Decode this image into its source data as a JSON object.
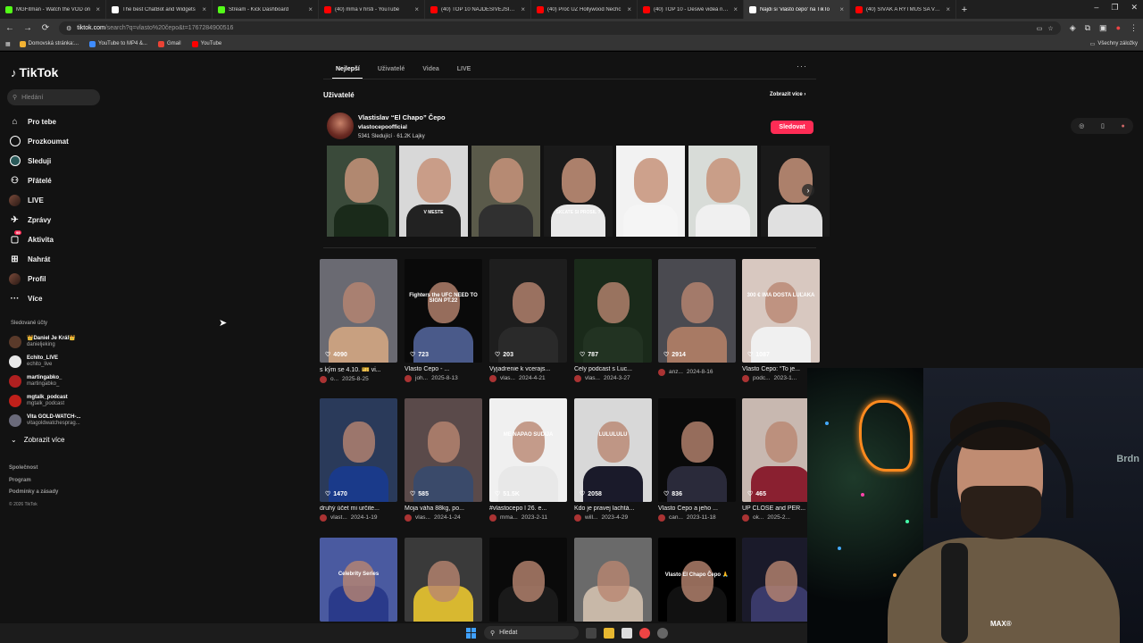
{
  "browser": {
    "tabs": [
      {
        "title": "MGFitman - Watch the VOD on",
        "icon_color": "#53fc18",
        "active": false
      },
      {
        "title": "The best ChatBot and Widgets",
        "icon_color": "#ffffff",
        "active": false
      },
      {
        "title": "Stream - Kick Dashboard",
        "icon_color": "#53fc18",
        "active": false
      },
      {
        "title": "(40) mma v hrsti - YouTube",
        "icon_color": "#ff0000",
        "active": false
      },
      {
        "title": "(40) TOP 10 NAJDESIVEJŠÍCH P",
        "icon_color": "#ff0000",
        "active": false
      },
      {
        "title": "(40) Proč UŽ Hollywood Nechc",
        "icon_color": "#ff0000",
        "active": false
      },
      {
        "title": "(40) TOP 10 - Desivé videá natc",
        "icon_color": "#ff0000",
        "active": false
      },
      {
        "title": "Nájdi si 'vlasto čepo' na TikTo",
        "icon_color": "#ffffff",
        "active": true
      },
      {
        "title": "(40) SIVÁK A RYTMUS SA VYJAD",
        "icon_color": "#ff0000",
        "active": false
      }
    ],
    "close_glyph": "×",
    "new_tab_glyph": "+",
    "window_controls": [
      "–",
      "❐",
      "✕"
    ],
    "url_host": "tiktok.com",
    "url_path": "/search?q=vlasto%20čepo&t=1767284900516",
    "bookmarks": [
      {
        "label": "Domovská stránka:...",
        "color": "#f2b233"
      },
      {
        "label": "YouTube to MP4 &...",
        "color": "#3f8cff"
      },
      {
        "label": "Gmail",
        "color": "#ea4335"
      },
      {
        "label": "YouTube",
        "color": "#ff0000"
      }
    ],
    "bookmarks_folder": "Všechny záložky"
  },
  "sidebar": {
    "logo": "TikTok",
    "search_placeholder": "Hledání",
    "nav": [
      {
        "label": "Pro tebe",
        "icon": "home-icon"
      },
      {
        "label": "Prozkoumat",
        "icon": "compass-icon"
      },
      {
        "label": "Sleduji",
        "icon": "following-icon"
      },
      {
        "label": "Přátelé",
        "icon": "friends-icon"
      },
      {
        "label": "LIVE",
        "icon": "live-icon"
      },
      {
        "label": "Zprávy",
        "icon": "messages-icon"
      },
      {
        "label": "Aktivita",
        "icon": "activity-icon",
        "badge": "99"
      },
      {
        "label": "Nahrát",
        "icon": "upload-icon"
      },
      {
        "label": "Profil",
        "icon": "profile-icon"
      },
      {
        "label": "Více",
        "icon": "more-icon"
      }
    ],
    "followed_header": "Sledované účty",
    "accounts": [
      {
        "name": "👑Daniel Je Král👑",
        "handle": "danieljeking",
        "color": "#5a3a2a"
      },
      {
        "name": "Echito_LIVE",
        "handle": "echito_live",
        "color": "#e8e8e8"
      },
      {
        "name": "martingabko_",
        "handle": "martingabko_",
        "color": "#b02020"
      },
      {
        "name": "mgtalk_podcast",
        "handle": "mgtalk_podcast",
        "color": "#c0201a"
      },
      {
        "name": "Vita GOLD-WATCH-...",
        "handle": "vitagoldwatchesprag...",
        "color": "#6a6a7a"
      }
    ],
    "show_more": "Zobrazit více",
    "footer_links": [
      "Společnost",
      "Program",
      "Podmínky a zásady"
    ],
    "copyright": "© 2026 TikTok"
  },
  "main": {
    "tabs": [
      "Nejlepší",
      "Uživatelé",
      "Videa",
      "LIVE"
    ],
    "users_header": "Uživatelé",
    "see_more": "Zobrazit více",
    "user": {
      "name": "Vlastislav “El Chapo” Čepo",
      "handle": "vlastocepoofficial",
      "followers": "5341 Sledující",
      "likes": "61.2K Lajky",
      "follow_label": "Sledovat"
    },
    "strip": [
      {
        "caption": "",
        "bg": "#3a4a3a",
        "body": "#1a2a1a"
      },
      {
        "caption": "V MESTE",
        "bg": "#d8d8d8",
        "body": "#222"
      },
      {
        "caption": "",
        "bg": "#5a5a4a",
        "body": "#303030"
      },
      {
        "caption": "SKĽATE SI PROSIL ?",
        "bg": "#1a1a1a",
        "body": "#e8e8e8"
      },
      {
        "caption": "",
        "bg": "#f2f2f2",
        "body": "#f5f5f5"
      },
      {
        "caption": "",
        "bg": "#d8dcd8",
        "body": "#f0f0f0"
      },
      {
        "caption": "",
        "bg": "#1a1a1a",
        "body": "#e0e0e0"
      }
    ],
    "videos": [
      {
        "likes": "4090",
        "desc": "s kým se 4.10. 🎫 vi...",
        "author": "o...",
        "date": "2025-8-25",
        "bg": "#6a6a72",
        "body": "#c8a080",
        "overlay": ""
      },
      {
        "likes": "723",
        "desc": "Vlasto Čepo - ...",
        "author": "joh...",
        "date": "2025-8-13",
        "bg": "#0a0a0a",
        "body": "#4a5a8a",
        "overlay": "Fighters the UFC NEED TO SIGN PT.22"
      },
      {
        "likes": "203",
        "desc": "Vyjadrenie k vcerajs...",
        "author": "vlas...",
        "date": "2024-4-21",
        "bg": "#1e1e1e",
        "body": "#2a2a2a",
        "overlay": ""
      },
      {
        "likes": "787",
        "desc": "Cely podcast s Luc...",
        "author": "vlas...",
        "date": "2024-3-27",
        "bg": "#1a2a1a",
        "body": "#223322",
        "overlay": ""
      },
      {
        "likes": "2914",
        "desc": "",
        "author": "anz...",
        "date": "2024-8-16",
        "bg": "#4a4a50",
        "body": "#a87a64",
        "overlay": ""
      },
      {
        "likes": "1087",
        "desc": "Vlasto Čepo: “To je...",
        "author": "podc...",
        "date": "2023-1...",
        "bg": "#d8c8c0",
        "body": "#f0f0f0",
        "overlay": "300 € IMA DOSTA LUĽAKA"
      },
      {
        "likes": "1470",
        "desc": "druhý účet mi určite...",
        "author": "vlast...",
        "date": "2024-1-19",
        "bg": "#2a3a5a",
        "body": "#1a3a8a",
        "overlay": ""
      },
      {
        "likes": "585",
        "desc": "Moja váha 88kg, po...",
        "author": "vlas...",
        "date": "2024-1-24",
        "bg": "#5a4a4a",
        "body": "#3a4a6a",
        "overlay": ""
      },
      {
        "likes": "51.5K",
        "desc": "#vlastocepo l 26. e...",
        "author": "mma...",
        "date": "2023-2-11",
        "bg": "#f0f0f0",
        "body": "#e8e8e8",
        "overlay": "ME NAPAO SUDIJA"
      },
      {
        "likes": "2058",
        "desc": "Kdo je pravej lachtá...",
        "author": "will...",
        "date": "2023-4-29",
        "bg": "#d8d8d8",
        "body": "#1a1a2a",
        "overlay": "LULULULU"
      },
      {
        "likes": "836",
        "desc": "Vlasto Čepo a jeho ...",
        "author": "can...",
        "date": "2023-11-18",
        "bg": "#0a0a0a",
        "body": "#2a2a3a",
        "overlay": ""
      },
      {
        "likes": "465",
        "desc": "UP CLOSE and PER...",
        "author": "ok...",
        "date": "2025-2...",
        "bg": "#c8b8b0",
        "body": "#8a2030",
        "overlay": ""
      },
      {
        "likes": "",
        "desc": "",
        "author": "",
        "date": "",
        "bg": "#4a5aa0",
        "body": "#2a3a8a",
        "overlay": "Celebrity Series"
      },
      {
        "likes": "",
        "desc": "",
        "author": "",
        "date": "",
        "bg": "#3a3a3a",
        "body": "#d8b830",
        "overlay": ""
      },
      {
        "likes": "",
        "desc": "",
        "author": "",
        "date": "",
        "bg": "#0a0a0a",
        "body": "#1a1a1a",
        "overlay": ""
      },
      {
        "likes": "",
        "desc": "",
        "author": "",
        "date": "",
        "bg": "#6a6a6a",
        "body": "#c8b8a8",
        "overlay": ""
      },
      {
        "likes": "",
        "desc": "",
        "author": "",
        "date": "",
        "bg": "#000000",
        "body": "#111111",
        "overlay": "Vlasto El Chapo Čepo 🙏"
      },
      {
        "likes": "",
        "desc": "",
        "author": "",
        "date": "",
        "bg": "#1a1a2a",
        "body": "#3a3a6a",
        "overlay": ""
      }
    ]
  },
  "webcam": {
    "brand_text": "MAX®",
    "side_text": "Brdn"
  },
  "taskbar": {
    "search_label": "Hledat"
  },
  "colors": {
    "accent": "#fe2c55",
    "bg": "#121212"
  }
}
